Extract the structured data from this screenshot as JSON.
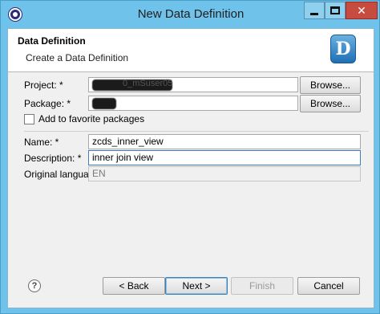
{
  "window": {
    "title": "New Data Definition",
    "controls": {
      "minimize": "",
      "maximize": "",
      "close": "✕"
    }
  },
  "banner": {
    "title": "Data Definition",
    "subtitle": "Create a Data Definition",
    "icon_letter": "D"
  },
  "form": {
    "project_label": "Project: *",
    "project_value": "0_mSuser05",
    "project_browse": "Browse...",
    "package_label": "Package: *",
    "package_value": "",
    "package_browse": "Browse...",
    "favorite_label": "Add to favorite packages",
    "favorite_checked": false,
    "name_label": "Name: *",
    "name_value": "zcds_inner_view",
    "description_label": "Description: *",
    "description_value": "inner join view",
    "original_language_label": "Original language:",
    "original_language_value": "EN"
  },
  "footer": {
    "help_glyph": "?",
    "back": "< Back",
    "next": "Next >",
    "finish": "Finish",
    "cancel": "Cancel"
  },
  "colors": {
    "titlebar": "#6fc3eb",
    "close_button": "#c74b3f",
    "client_background": "#f0f0f0",
    "icon_blue": "#1f6fb5"
  }
}
